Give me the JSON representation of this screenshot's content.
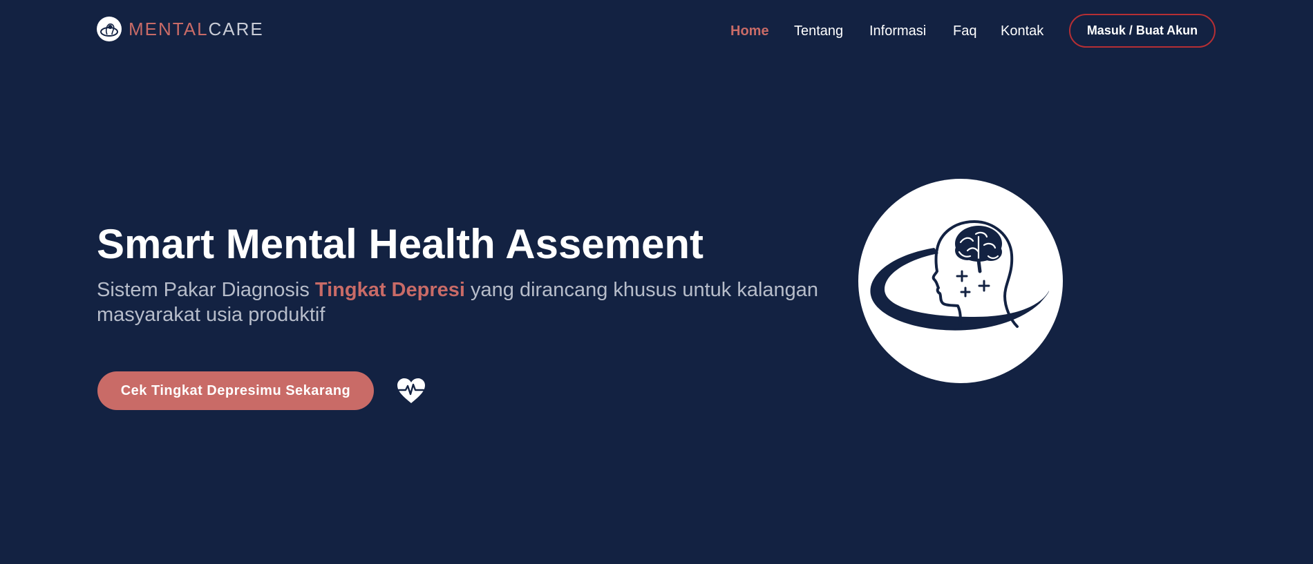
{
  "brand": {
    "name_part1": "MENTAL",
    "name_part2": "CARE",
    "logo_icon": "brain-head-icon"
  },
  "nav": {
    "items": [
      {
        "label": "Home",
        "active": true
      },
      {
        "label": "Tentang",
        "active": false
      },
      {
        "label": "Informasi",
        "active": false
      },
      {
        "label": "Faq",
        "active": false
      },
      {
        "label": "Kontak",
        "active": false
      }
    ],
    "login_label": "Masuk / Buat Akun"
  },
  "hero": {
    "title": "Smart Mental Health Assement",
    "subtitle_before": "Sistem Pakar Diagnosis ",
    "subtitle_highlight": "Tingkat Depresi",
    "subtitle_after": " yang dirancang khusus untuk kalangan masyarakat usia produktif",
    "cta_label": "Cek Tingkat Depresimu Sekarang",
    "secondary_icon": "heart-pulse-icon",
    "illustration_icon": "mental-health-head-icon"
  },
  "colors": {
    "background": "#132242",
    "accent": "#c96b67",
    "button_border": "#b62f34",
    "text": "#ffffff",
    "muted_text": "#b7bdca"
  }
}
